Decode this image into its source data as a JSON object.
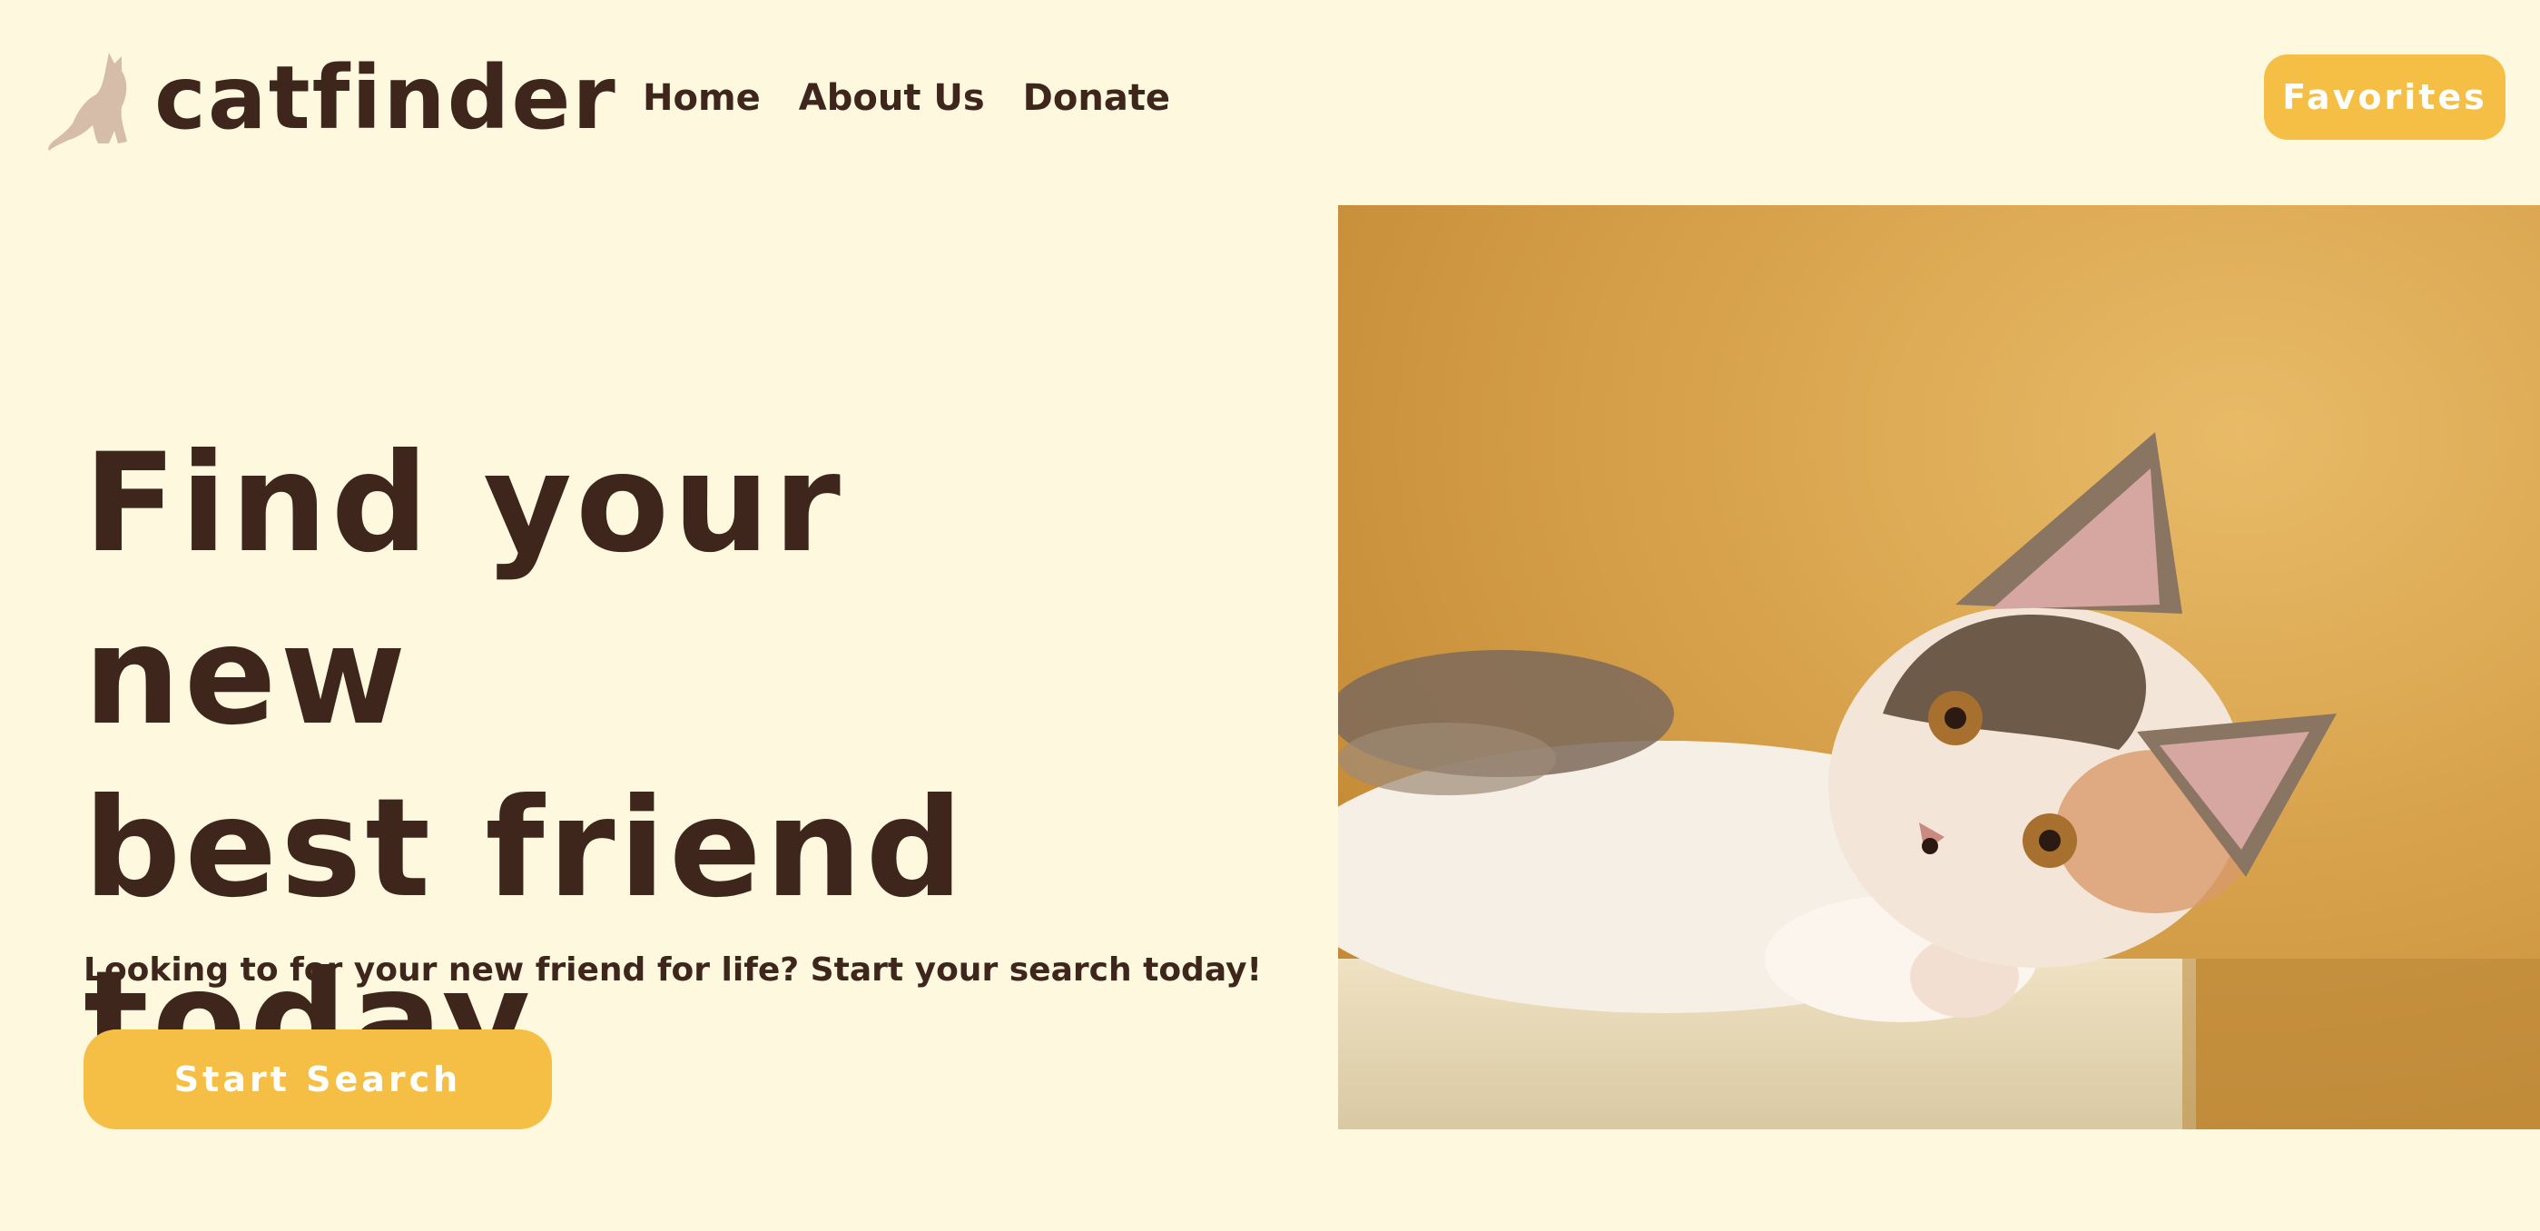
{
  "brand": {
    "name": "catfinder",
    "logo_icon": "cat-silhouette-icon"
  },
  "nav": {
    "items": [
      {
        "label": "Home"
      },
      {
        "label": "About Us"
      },
      {
        "label": "Donate"
      }
    ]
  },
  "header": {
    "favorites_label": "Favorites"
  },
  "hero": {
    "title_lines": [
      "Find your new",
      "best friend",
      "today"
    ],
    "subtitle": "Looking to for your new friend for life? Start your search today!",
    "cta_label": "Start Search",
    "image_subject": "calico-kitten-photo"
  },
  "colors": {
    "background": "#fdf8de",
    "text": "#3e261c",
    "accent": "#f4bf44",
    "logo_icon": "#d6bda9",
    "button_text": "#ffffff"
  }
}
